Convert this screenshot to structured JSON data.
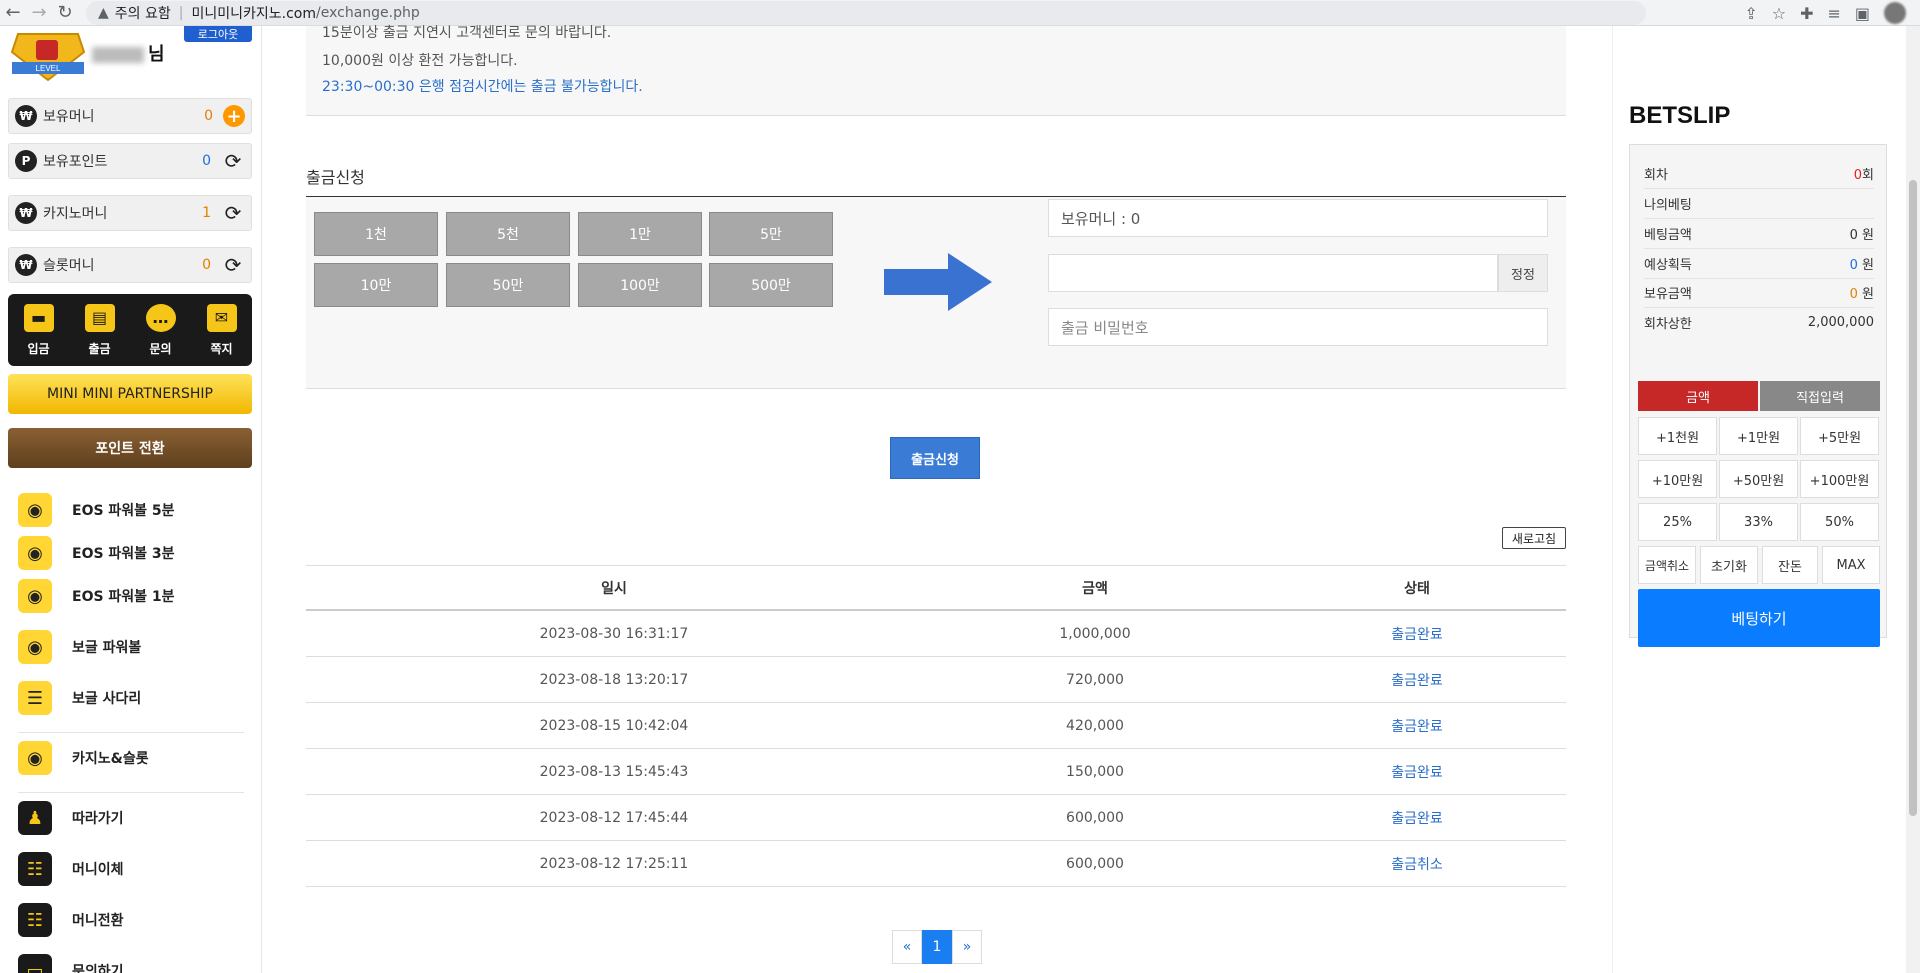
{
  "browser": {
    "warning": "주의 요함",
    "domain": "미니미니카지노.com",
    "path": "/exchange.php"
  },
  "sidebar": {
    "level_text": "LEVEL",
    "user_suffix": "님",
    "logout": "로그아웃",
    "money": [
      {
        "icon": "won",
        "label": "보유머니",
        "value": "0",
        "action": "plus"
      },
      {
        "icon": "P",
        "label": "보유포인트",
        "value": "0",
        "action": "refresh"
      },
      {
        "icon": "won",
        "label": "카지노머니",
        "value": "1",
        "action": "refresh"
      },
      {
        "icon": "won",
        "label": "슬롯머니",
        "value": "0",
        "action": "refresh"
      }
    ],
    "quick": [
      "입금",
      "출금",
      "문의",
      "쪽지"
    ],
    "partnership": "MINI MINI PARTNERSHIP",
    "point_convert": "포인트 전환",
    "games": [
      "EOS 파워볼 5분",
      "EOS 파워볼 3분",
      "EOS 파워볼 1분",
      "보글 파워볼",
      "보글 사다리",
      "카지노&슬롯",
      "따라가기",
      "머니이체",
      "머니전환",
      "문의하기"
    ]
  },
  "notice": {
    "line1": "15분이상 출금 지연시 고객센터로 문의 바랍니다.",
    "line2": "10,000원 이상 환전 가능합니다.",
    "line3": "23:30~00:30 은행 점검시간에는 출금 불가능합니다."
  },
  "withdraw": {
    "title": "출금신청",
    "amounts": [
      "1천",
      "5천",
      "1만",
      "5만",
      "10만",
      "50만",
      "100만",
      "500만"
    ],
    "balance_field": "보유머니 : 0",
    "amount_value": "",
    "reset": "정정",
    "password_placeholder": "출금 비밀번호",
    "submit": "출금신청"
  },
  "history": {
    "refresh": "새로고침",
    "headers": [
      "일시",
      "금액",
      "상태"
    ],
    "rows": [
      {
        "date": "2023-08-30 16:31:17",
        "amount": "1,000,000",
        "status": "출금완료"
      },
      {
        "date": "2023-08-18 13:20:17",
        "amount": "720,000",
        "status": "출금완료"
      },
      {
        "date": "2023-08-15 10:42:04",
        "amount": "420,000",
        "status": "출금완료"
      },
      {
        "date": "2023-08-13 15:45:43",
        "amount": "150,000",
        "status": "출금완료"
      },
      {
        "date": "2023-08-12 17:45:44",
        "amount": "600,000",
        "status": "출금완료"
      },
      {
        "date": "2023-08-12 17:25:11",
        "amount": "600,000",
        "status": "출금취소"
      }
    ],
    "pager": {
      "prev": "«",
      "current": "1",
      "next": "»"
    }
  },
  "betslip": {
    "title": "BETSLIP",
    "rows": {
      "round_label": "회차",
      "round_value": "0",
      "round_unit": "회",
      "mybet_label": "나의베팅",
      "betamt_label": "베팅금액",
      "betamt_value": "0 원",
      "expected_label": "예상획득",
      "expected_value": "0",
      "expected_unit": " 원",
      "holding_label": "보유금액",
      "holding_value": "0",
      "holding_unit": " 원",
      "limit_label": "회차상한",
      "limit_value": "2,000,000"
    },
    "tab_amount": "금액",
    "tab_direct": "직접입력",
    "quick_amounts": [
      "+1천원",
      "+1만원",
      "+5만원",
      "+10만원",
      "+50만원",
      "+100만원"
    ],
    "percents": [
      "25%",
      "33%",
      "50%"
    ],
    "controls": [
      "금액취소",
      "초기화",
      "잔돈",
      "MAX"
    ],
    "bet_button": "베팅하기"
  },
  "colors": {
    "accent_blue": "#3a7bd5",
    "status_blue": "#2a6fc9",
    "bet_blue": "#0a7cff",
    "tab_red": "#c62828",
    "gold": "#f5c518"
  }
}
